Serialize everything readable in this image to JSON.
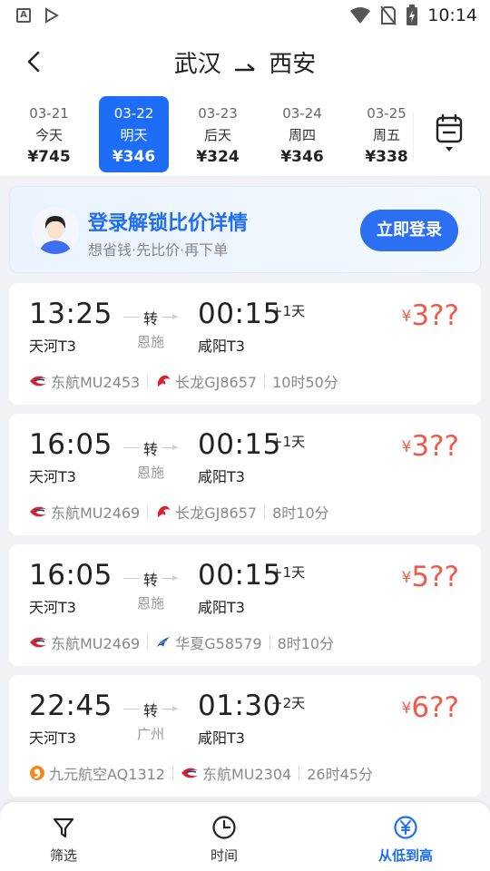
{
  "status_bar": {
    "time": "10:14"
  },
  "header": {
    "from": "武汉",
    "to": "西安"
  },
  "dates": [
    {
      "date": "03-21",
      "weekday": "今天",
      "price": "¥745",
      "selected": false
    },
    {
      "date": "03-22",
      "weekday": "明天",
      "price": "¥346",
      "selected": true
    },
    {
      "date": "03-23",
      "weekday": "后天",
      "price": "¥324",
      "selected": false
    },
    {
      "date": "03-24",
      "weekday": "周四",
      "price": "¥346",
      "selected": false
    },
    {
      "date": "03-25",
      "weekday": "周五",
      "price": "¥338",
      "selected": false
    }
  ],
  "banner": {
    "title": "登录解锁比价详情",
    "subtitle": "想省钱·先比价·再下单",
    "button": "立即登录"
  },
  "flights": [
    {
      "dep_time": "13:25",
      "dep_airport": "天河T3",
      "transfer_label": "转",
      "transfer_city": "恩施",
      "arr_time": "00:15",
      "plus_days": "+1天",
      "arr_airport": "咸阳T3",
      "yen": "¥",
      "price": "3??",
      "airline1": "东航MU2453",
      "airline1_icon": "china-eastern-icon",
      "airline2": "长龙GJ8657",
      "airline2_icon": "loong-air-icon",
      "duration": "10时50分"
    },
    {
      "dep_time": "16:05",
      "dep_airport": "天河T3",
      "transfer_label": "转",
      "transfer_city": "恩施",
      "arr_time": "00:15",
      "plus_days": "+1天",
      "arr_airport": "咸阳T3",
      "yen": "¥",
      "price": "3??",
      "airline1": "东航MU2469",
      "airline1_icon": "china-eastern-icon",
      "airline2": "长龙GJ8657",
      "airline2_icon": "loong-air-icon",
      "duration": "8时10分"
    },
    {
      "dep_time": "16:05",
      "dep_airport": "天河T3",
      "transfer_label": "转",
      "transfer_city": "恩施",
      "arr_time": "00:15",
      "plus_days": "+1天",
      "arr_airport": "咸阳T3",
      "yen": "¥",
      "price": "5??",
      "airline1": "东航MU2469",
      "airline1_icon": "china-eastern-icon",
      "airline2": "华夏G58579",
      "airline2_icon": "china-express-icon",
      "duration": "8时10分"
    },
    {
      "dep_time": "22:45",
      "dep_airport": "天河T3",
      "transfer_label": "转",
      "transfer_city": "广州",
      "arr_time": "01:30",
      "plus_days": "+2天",
      "arr_airport": "咸阳T3",
      "yen": "¥",
      "price": "6??",
      "airline1": "九元航空AQ1312",
      "airline1_icon": "9air-icon",
      "airline2": "东航MU2304",
      "airline2_icon": "china-eastern-icon",
      "duration": "26时45分"
    }
  ],
  "bottom_nav": [
    {
      "label": "筛选",
      "icon": "filter-icon",
      "active": false
    },
    {
      "label": "时间",
      "icon": "clock-icon",
      "active": false
    },
    {
      "label": "从低到高",
      "icon": "yen-circle-icon",
      "active": true
    }
  ],
  "colors": {
    "accent": "#1e6df7",
    "price": "#f15a4a"
  }
}
